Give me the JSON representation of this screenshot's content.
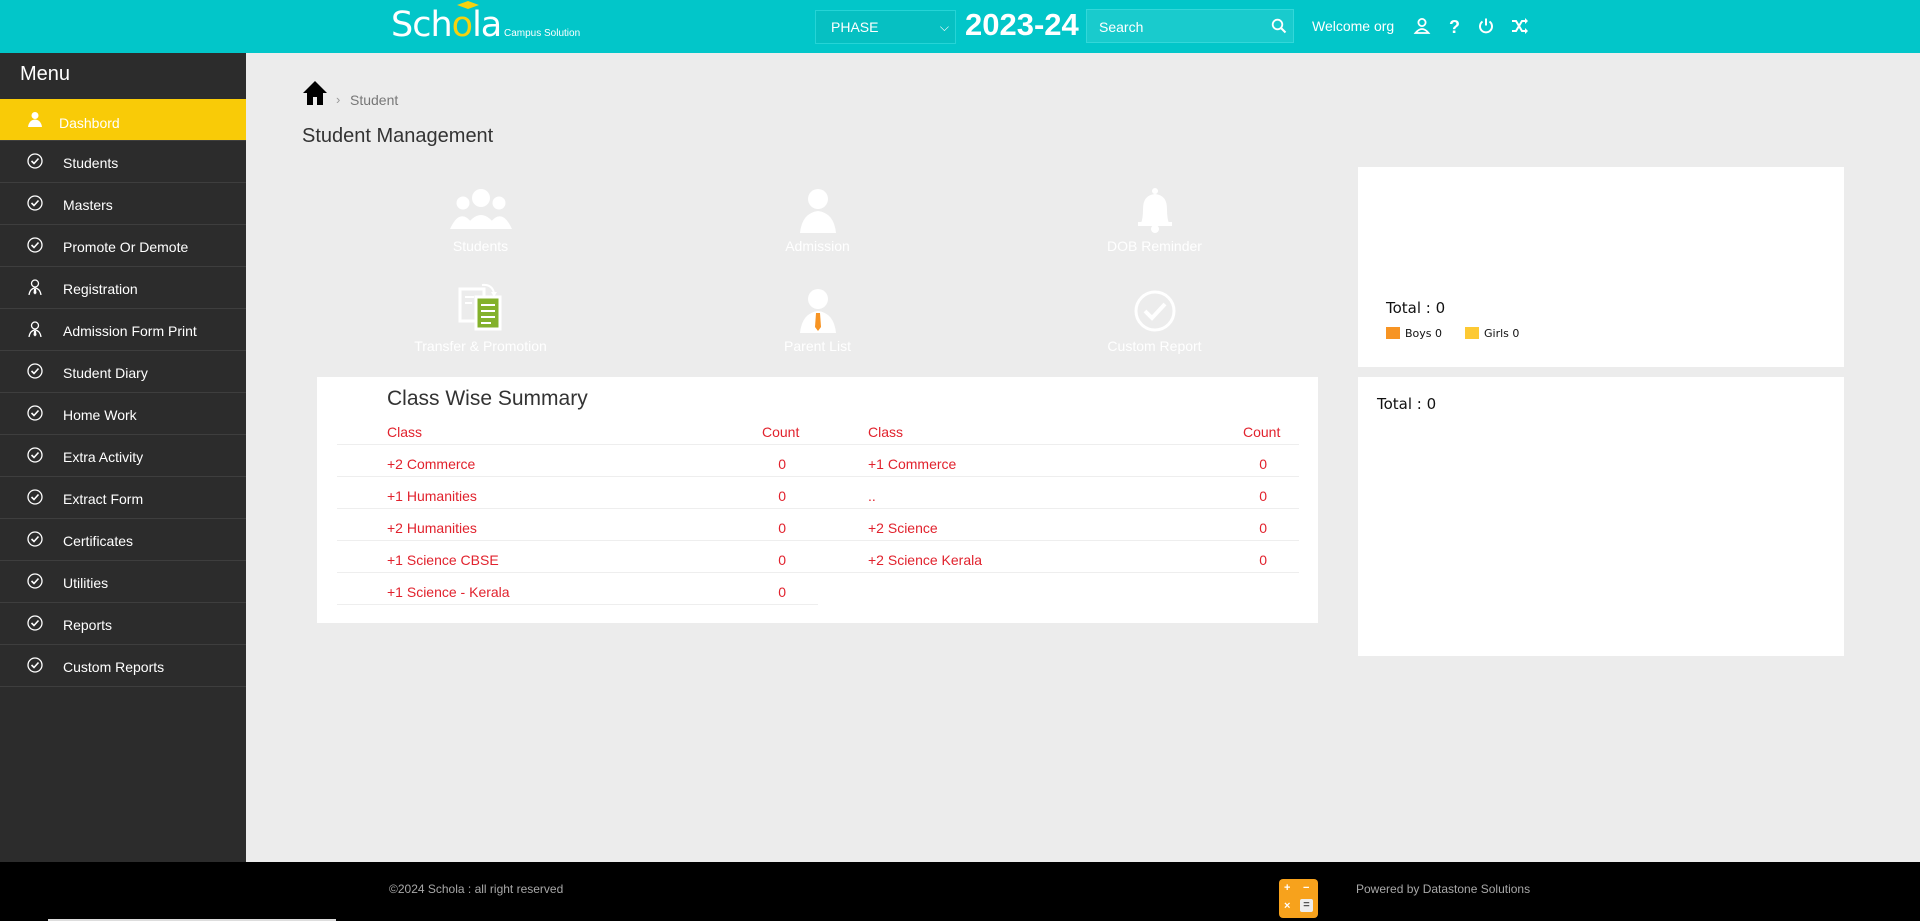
{
  "header": {
    "logo_text_prefix": "Sch",
    "logo_text_o": "o",
    "logo_text_suffix": "la",
    "logo_sub": "Campus Solution",
    "phase_selected": "PHASE",
    "year": "2023-24",
    "search_placeholder": "Search",
    "welcome": "Welcome org",
    "icons": [
      "user-icon",
      "help-icon",
      "power-icon",
      "shuffle-icon"
    ],
    "accent": "#02c6c9"
  },
  "sidebar": {
    "title": "Menu",
    "items": [
      {
        "label": "Dashbord",
        "icon": "user-icon",
        "active": true
      },
      {
        "label": "Students",
        "icon": "check-circle-icon"
      },
      {
        "label": "Masters",
        "icon": "check-circle-icon"
      },
      {
        "label": "Promote Or Demote",
        "icon": "check-circle-icon"
      },
      {
        "label": "Registration",
        "icon": "user-tie-icon"
      },
      {
        "label": "Admission Form Print",
        "icon": "user-tie-icon"
      },
      {
        "label": "Student Diary",
        "icon": "check-circle-icon"
      },
      {
        "label": "Home Work",
        "icon": "check-circle-icon"
      },
      {
        "label": "Extra Activity",
        "icon": "check-circle-icon"
      },
      {
        "label": "Extract Form",
        "icon": "check-circle-icon"
      },
      {
        "label": "Certificates",
        "icon": "check-circle-icon"
      },
      {
        "label": "Utilities",
        "icon": "check-circle-icon"
      },
      {
        "label": "Reports",
        "icon": "check-circle-icon"
      },
      {
        "label": "Custom Reports",
        "icon": "check-circle-icon"
      }
    ]
  },
  "breadcrumb": {
    "current": "Student",
    "separator": "›"
  },
  "page_title": "Student Management",
  "tiles": [
    {
      "label": "Students",
      "icon": "users-icon",
      "color": "#37a3da"
    },
    {
      "label": "Admission",
      "icon": "user-icon",
      "color": "#fdc933"
    },
    {
      "label": "DOB Reminder",
      "icon": "bell-icon",
      "color": "#02c6c9"
    },
    {
      "label": "Transfer & Promotion",
      "icon": "documents-icon",
      "color": "#83b12b"
    },
    {
      "label": "Parent List",
      "icon": "user-tie-icon",
      "color": "#f79423"
    },
    {
      "label": "Custom Report",
      "icon": "check-circle-icon",
      "color": "#e21b34"
    }
  ],
  "summary": {
    "title": "Class Wise Summary",
    "col_class": "Class",
    "col_count": "Count",
    "left": [
      {
        "class": "+2 Commerce",
        "count": "0"
      },
      {
        "class": "+1 Humanities",
        "count": "0"
      },
      {
        "class": "+2 Humanities",
        "count": "0"
      },
      {
        "class": "+1 Science CBSE",
        "count": "0"
      },
      {
        "class": "+1 Science - Kerala",
        "count": "0"
      }
    ],
    "right": [
      {
        "class": "+1 Commerce",
        "count": "0"
      },
      {
        "class": "..",
        "count": "0"
      },
      {
        "class": "+2 Science",
        "count": "0"
      },
      {
        "class": "+2 Science Kerala",
        "count": "0"
      }
    ]
  },
  "gender_chart": {
    "total": "Total : 0",
    "boys": "Boys 0",
    "girls": "Girls 0",
    "boys_color": "#f79423",
    "girls_color": "#fdc933"
  },
  "second_chart": {
    "total": "Total : 0"
  },
  "footer": {
    "copyright": "©2024 Schola : all right reserved",
    "powered": "Powered by Datastone Solutions"
  }
}
